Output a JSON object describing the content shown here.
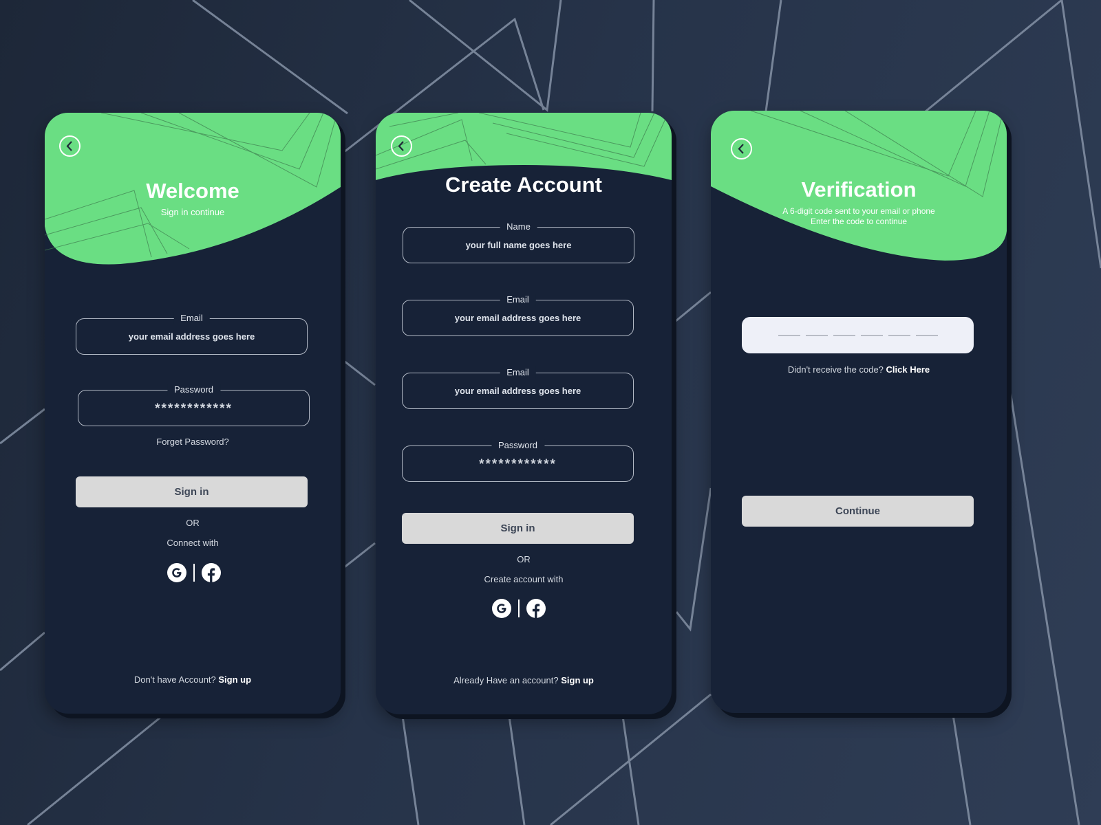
{
  "login": {
    "title": "Welcome",
    "subtitle": "Sign in continue",
    "email_label": "Email",
    "email_value": "your email address goes here",
    "password_label": "Password",
    "password_value": "************",
    "forgot": "Forget Password?",
    "signin_button": "Sign in",
    "or": "OR",
    "connect": "Connect with",
    "bottom_prefix": "Don't have Account?",
    "bottom_link": "Sign up"
  },
  "signup": {
    "title": "Create Account",
    "name_label": "Name",
    "name_value": "your full name goes here",
    "email_label": "Email",
    "email_value": "your email address goes here",
    "email2_label": "Email",
    "email2_value": "your email address goes here",
    "password_label": "Password",
    "password_value": "************",
    "signin_button": "Sign in",
    "or": "OR",
    "connect": "Create account with",
    "bottom_prefix": "Already Have an account?",
    "bottom_link": "Sign up"
  },
  "verify": {
    "title": "Verification",
    "subtitle_line1": "A 6-digit code sent to your email or phone",
    "subtitle_line2": "Enter the code to continue",
    "resend_prefix": "Didn't receive the code?",
    "resend_link": "Click Here",
    "continue_button": "Continue"
  },
  "icons": [
    "back-arrow-icon",
    "google-icon",
    "facebook-icon"
  ],
  "colors": {
    "accent": "#6ade83",
    "card": "#172237",
    "button": "#d9d9d9",
    "background": "#283448"
  }
}
